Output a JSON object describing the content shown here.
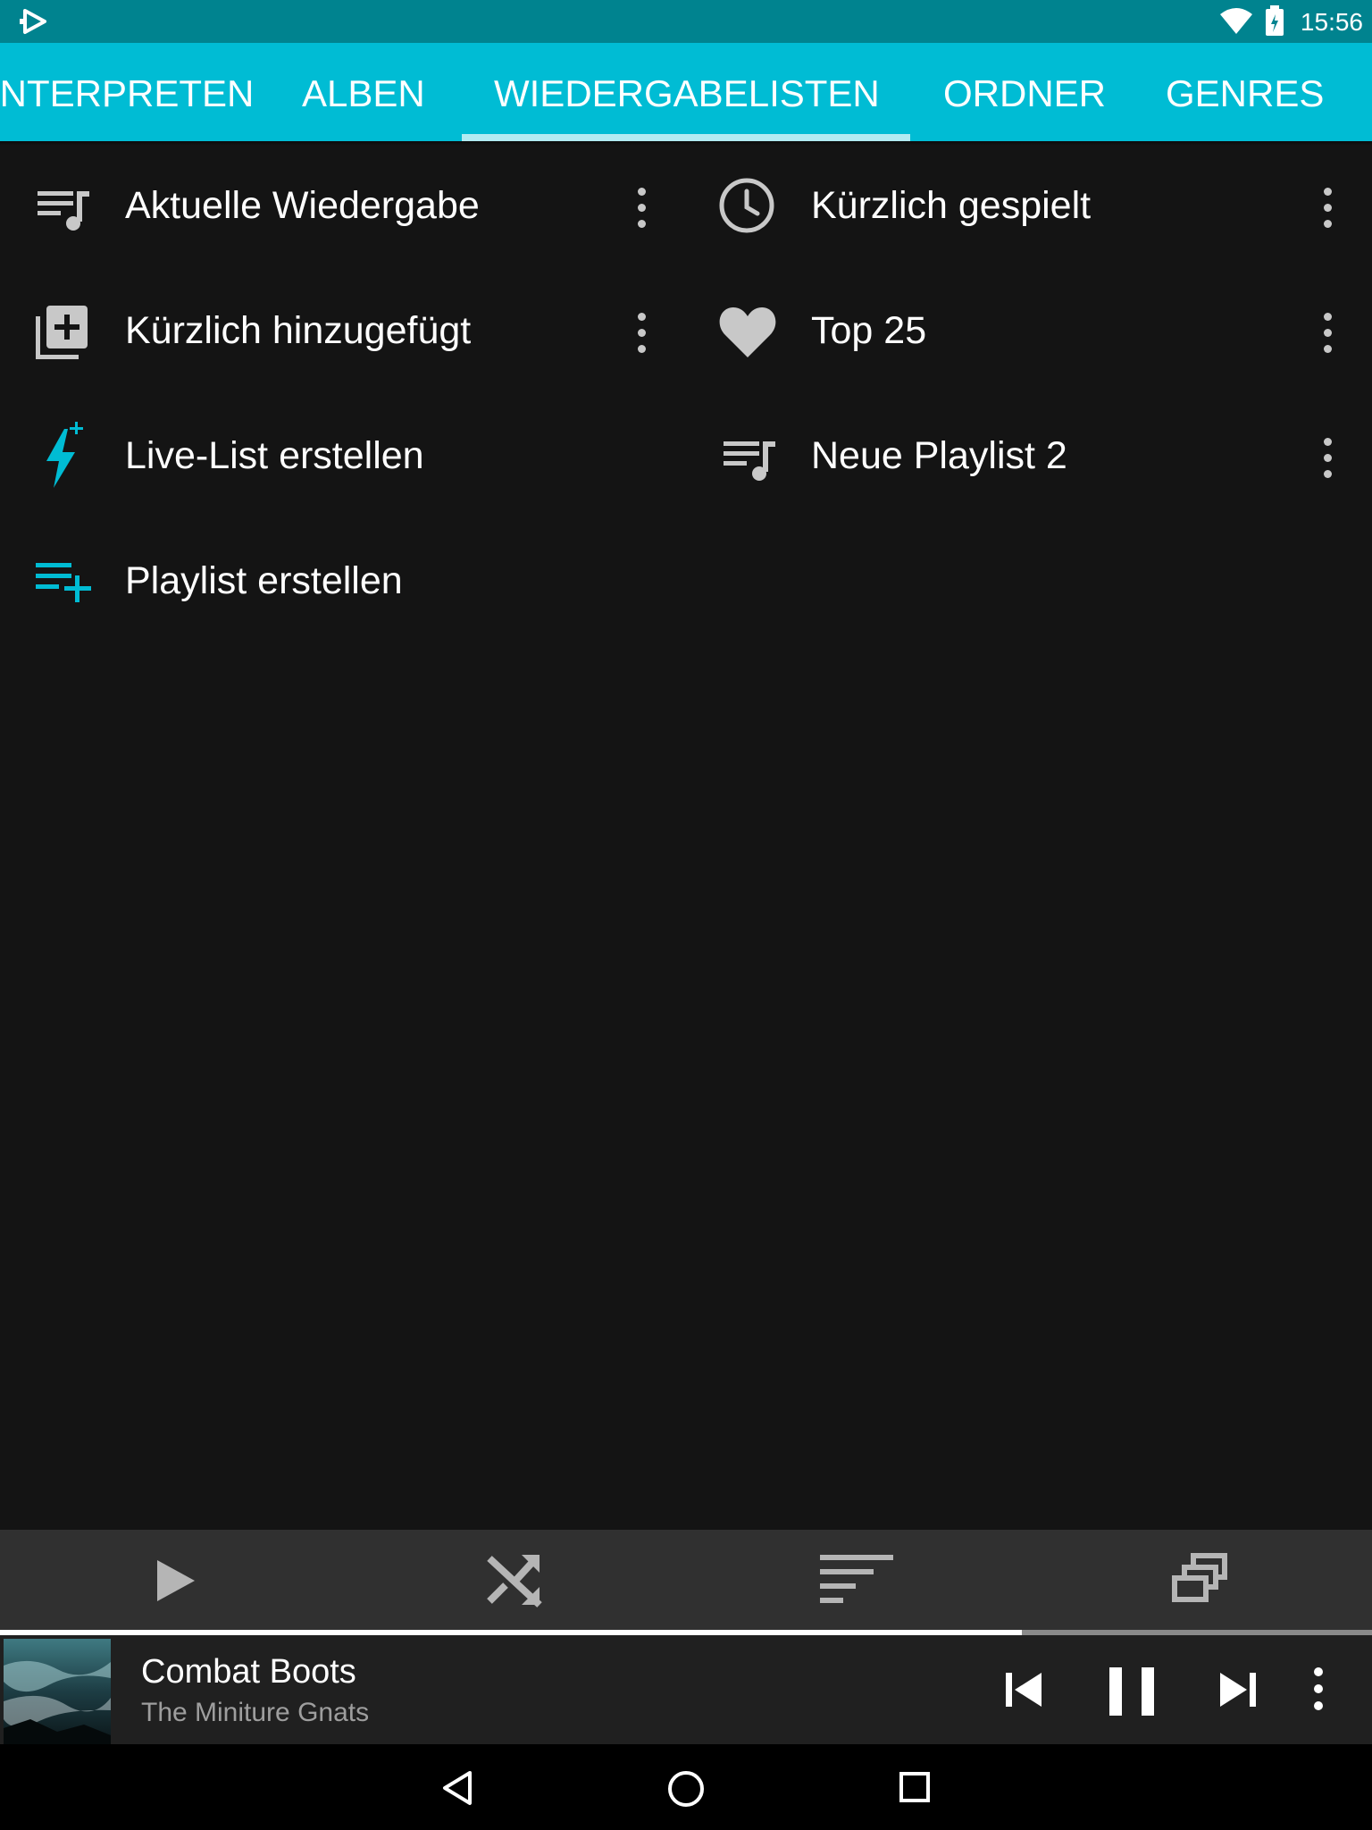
{
  "status_bar": {
    "time": "15:56"
  },
  "tabs": [
    {
      "label": "INTERPRETEN",
      "selected": false
    },
    {
      "label": "ALBEN",
      "selected": false
    },
    {
      "label": "WIEDERGABELISTEN",
      "selected": true
    },
    {
      "label": "ORDNER",
      "selected": false
    },
    {
      "label": "GENRES",
      "selected": false
    }
  ],
  "playlists": {
    "left": [
      {
        "label": "Aktuelle Wiedergabe",
        "icon": "queue-music-icon",
        "has_menu": true
      },
      {
        "label": "Kürzlich hinzugefügt",
        "icon": "library-add-icon",
        "has_menu": true
      },
      {
        "label": "Live-List erstellen",
        "icon": "lightning-add-icon",
        "has_menu": false
      },
      {
        "label": "Playlist erstellen",
        "icon": "playlist-add-icon",
        "has_menu": false
      }
    ],
    "right": [
      {
        "label": "Kürzlich gespielt",
        "icon": "clock-icon",
        "has_menu": true
      },
      {
        "label": "Top 25",
        "icon": "heart-icon",
        "has_menu": true
      },
      {
        "label": "Neue Playlist 2",
        "icon": "queue-music-icon",
        "has_menu": true
      }
    ]
  },
  "toolbar": {
    "buttons": [
      "play-icon",
      "shuffle-icon",
      "sort-icon",
      "multi-select-icon"
    ]
  },
  "now_playing": {
    "title": "Combat Boots",
    "artist": "The Miniture Gnats",
    "progress": 0.745,
    "controls": [
      "skip-previous-icon",
      "pause-icon",
      "skip-next-icon",
      "more-vert-icon"
    ]
  },
  "nav_bar": [
    "back-icon",
    "home-icon",
    "recents-icon"
  ],
  "colors": {
    "accent": "#00bcd4",
    "status_bar": "#00838f",
    "background": "#141414",
    "toolbar": "#303030",
    "icon_gray": "#c8c8c8"
  }
}
